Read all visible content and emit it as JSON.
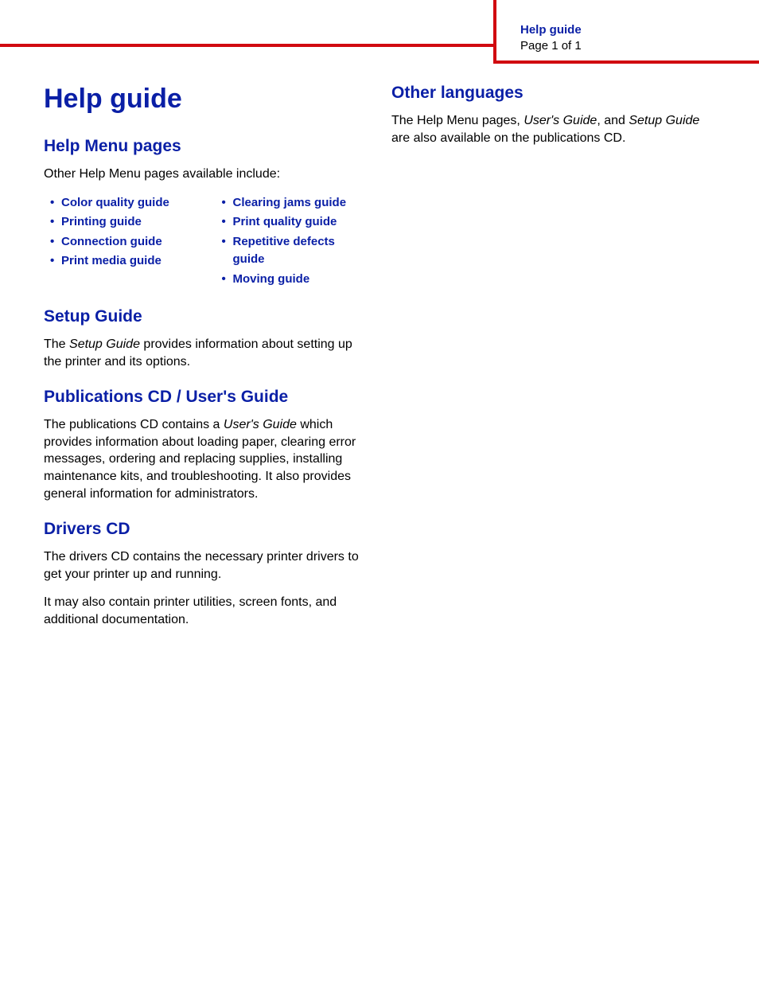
{
  "header": {
    "title": "Help guide",
    "page": "Page 1 of 1"
  },
  "left": {
    "h1": "Help guide",
    "help_menu": {
      "heading": "Help Menu pages",
      "intro": "Other Help Menu pages available include:",
      "col1": [
        "Color quality guide",
        "Printing guide",
        "Connection guide",
        "Print media guide"
      ],
      "col2": [
        "Clearing jams guide",
        "Print quality guide",
        "Repetitive defects guide",
        "Moving guide"
      ]
    },
    "setup": {
      "heading": "Setup Guide",
      "text_pre": "The ",
      "text_em": "Setup Guide",
      "text_post": " provides information about setting up the printer and its options."
    },
    "pubs": {
      "heading": "Publications CD / User's Guide",
      "text_pre": "The publications CD contains a ",
      "text_em": "User's Guide",
      "text_post": " which provides information about loading paper, clearing error messages, ordering and replacing supplies, installing maintenance kits, and troubleshooting. It also provides general information for administrators."
    },
    "drivers": {
      "heading": "Drivers CD",
      "p1": "The drivers CD contains the necessary printer drivers to get your printer up and running.",
      "p2": "It may also contain printer utilities, screen fonts, and additional documentation."
    }
  },
  "right": {
    "other_lang": {
      "heading": "Other languages",
      "text_pre": "The Help Menu pages, ",
      "text_em1": "User's Guide",
      "text_mid": ", and ",
      "text_em2": "Setup Guide",
      "text_post": " are also available on the publications CD."
    }
  }
}
